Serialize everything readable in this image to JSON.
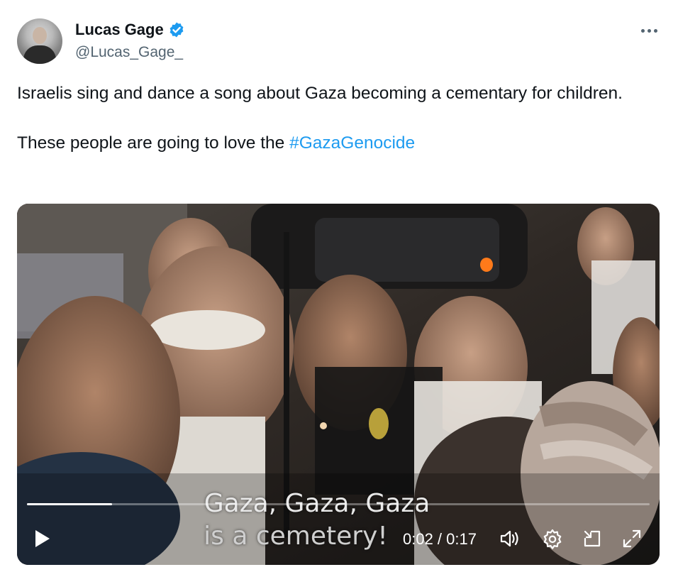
{
  "author": {
    "name": "Lucas Gage",
    "handle": "@Lucas_Gage_",
    "verified": true,
    "verified_color": "#1d9bf0"
  },
  "tweet": {
    "line1": "Israelis sing and dance a song about Gaza becoming a cementary for children.",
    "line2_prefix": "These people are going to love the ",
    "hashtag": "#GazaGenocide",
    "hashtag_color": "#1d9bf0"
  },
  "video": {
    "subtitle_line1": "Gaza, Gaza, Gaza",
    "subtitle_line2": "is a cemetery!",
    "time_display": "0:02 / 0:17",
    "progress_fraction": 0.137
  },
  "icons": {
    "more": "more-icon",
    "play": "play-icon",
    "volume": "volume-icon",
    "settings": "gear-icon",
    "pip": "pip-icon",
    "fullscreen": "fullscreen-icon"
  }
}
